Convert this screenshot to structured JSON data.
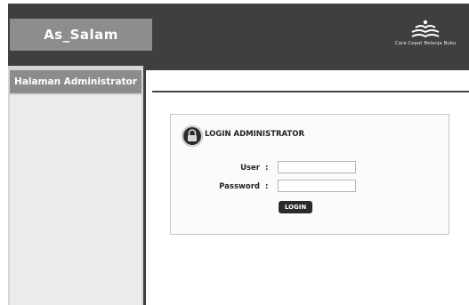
{
  "header": {
    "logo_text": "As_Salam",
    "tagline": "Cara Cepat Belanja Buku"
  },
  "sidebar": {
    "title": "Halaman Administrator"
  },
  "login": {
    "title": "LOGIN ADMINISTRATOR",
    "user_label": "User",
    "password_label": "Password",
    "colon": ":",
    "user_value": "",
    "password_value": "",
    "button_label": "LOGIN"
  },
  "colors": {
    "header_bg": "#3f3f3f",
    "logo_box": "#8d8d8d",
    "sidebar_head": "#8c8c8c",
    "sidebar_body": "#ececec",
    "button": "#2a2a2a"
  },
  "icons": {
    "brand": "book-bird-icon",
    "lock": "lock-icon"
  }
}
